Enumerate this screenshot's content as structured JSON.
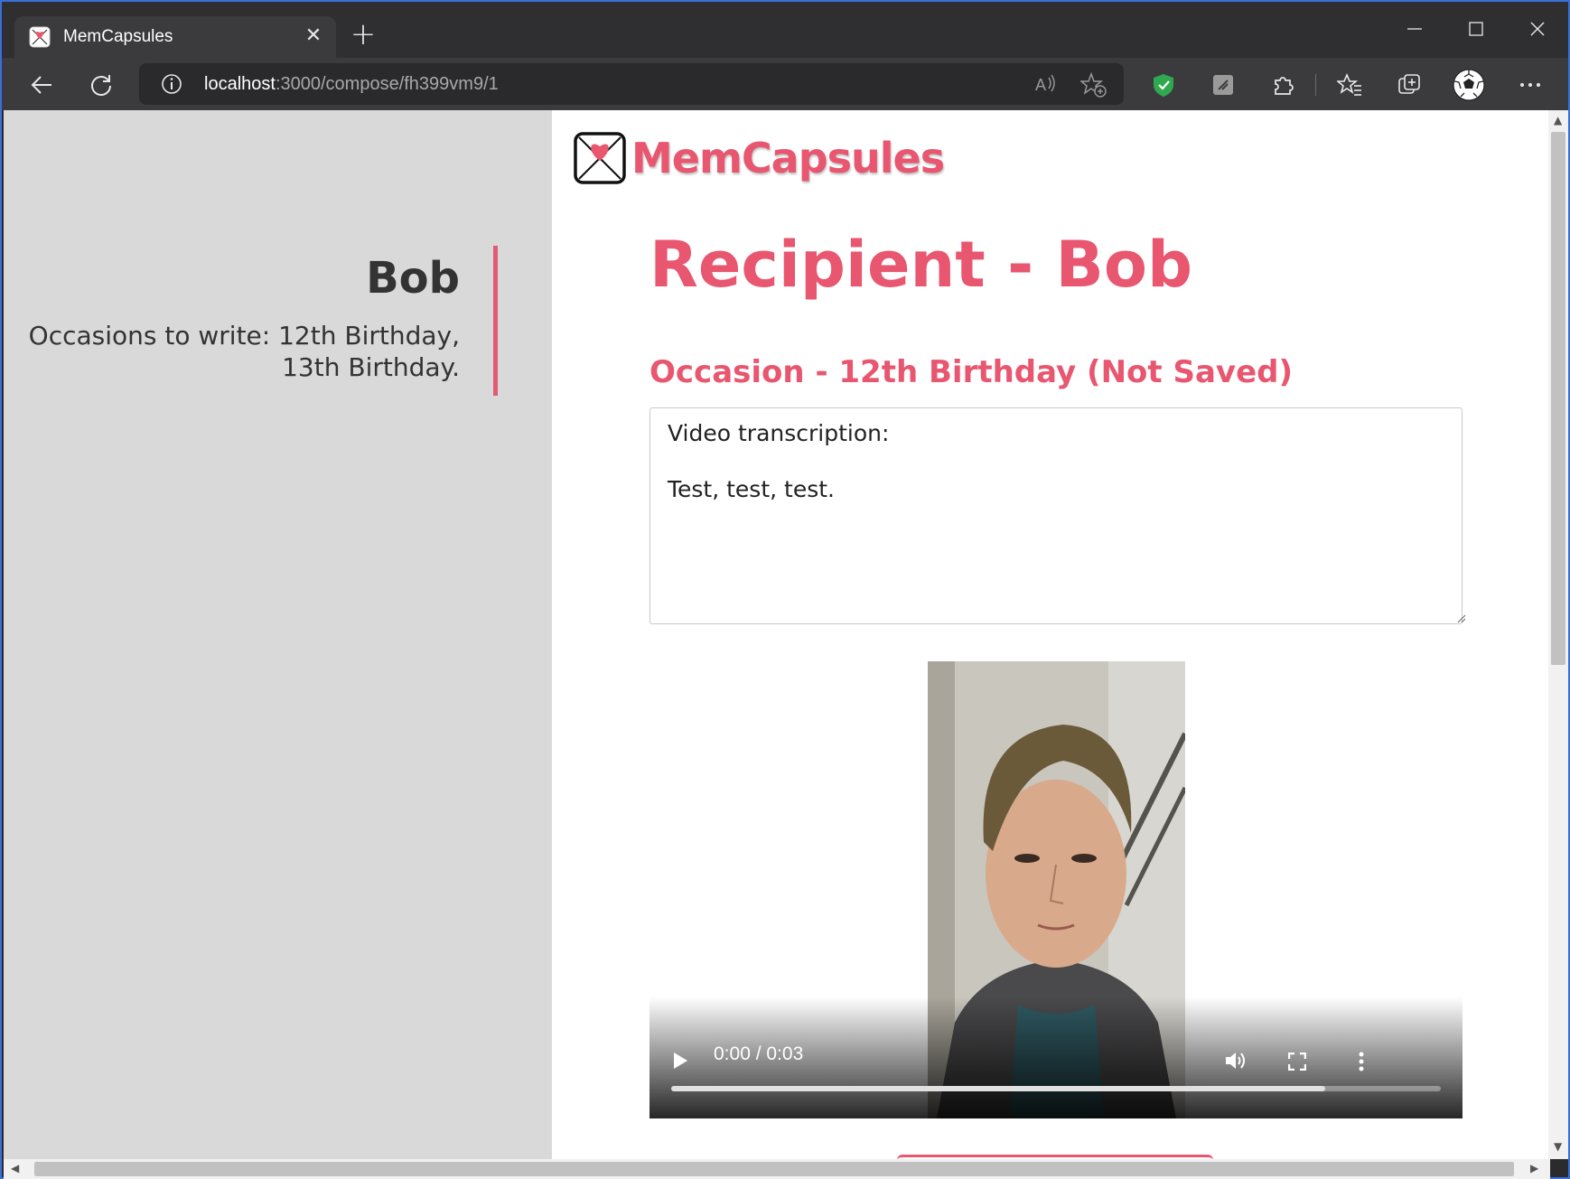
{
  "browser": {
    "tab_title": "MemCapsules",
    "tab_close": "✕",
    "new_tab": "+",
    "url_host": "localhost",
    "url_path": ":3000/compose/fh399vm9/1"
  },
  "sidebar": {
    "name": "Bob",
    "occasions_line1": "Occasions to write: 12th Birthday,",
    "occasions_line2": "13th Birthday."
  },
  "main": {
    "logo_text": "MemCapsules",
    "page_title": "Recipient - Bob",
    "occasion_title": "Occasion - 12th Birthday (Not Saved)",
    "transcript": "Video transcription:\n\nTest, test, test."
  },
  "video": {
    "time": "0:00 / 0:03",
    "progress_buffered": 0.85,
    "progress_played": 0.0
  },
  "colors": {
    "accent": "#e8566f",
    "sidebar_bg": "#d9d9d9"
  }
}
